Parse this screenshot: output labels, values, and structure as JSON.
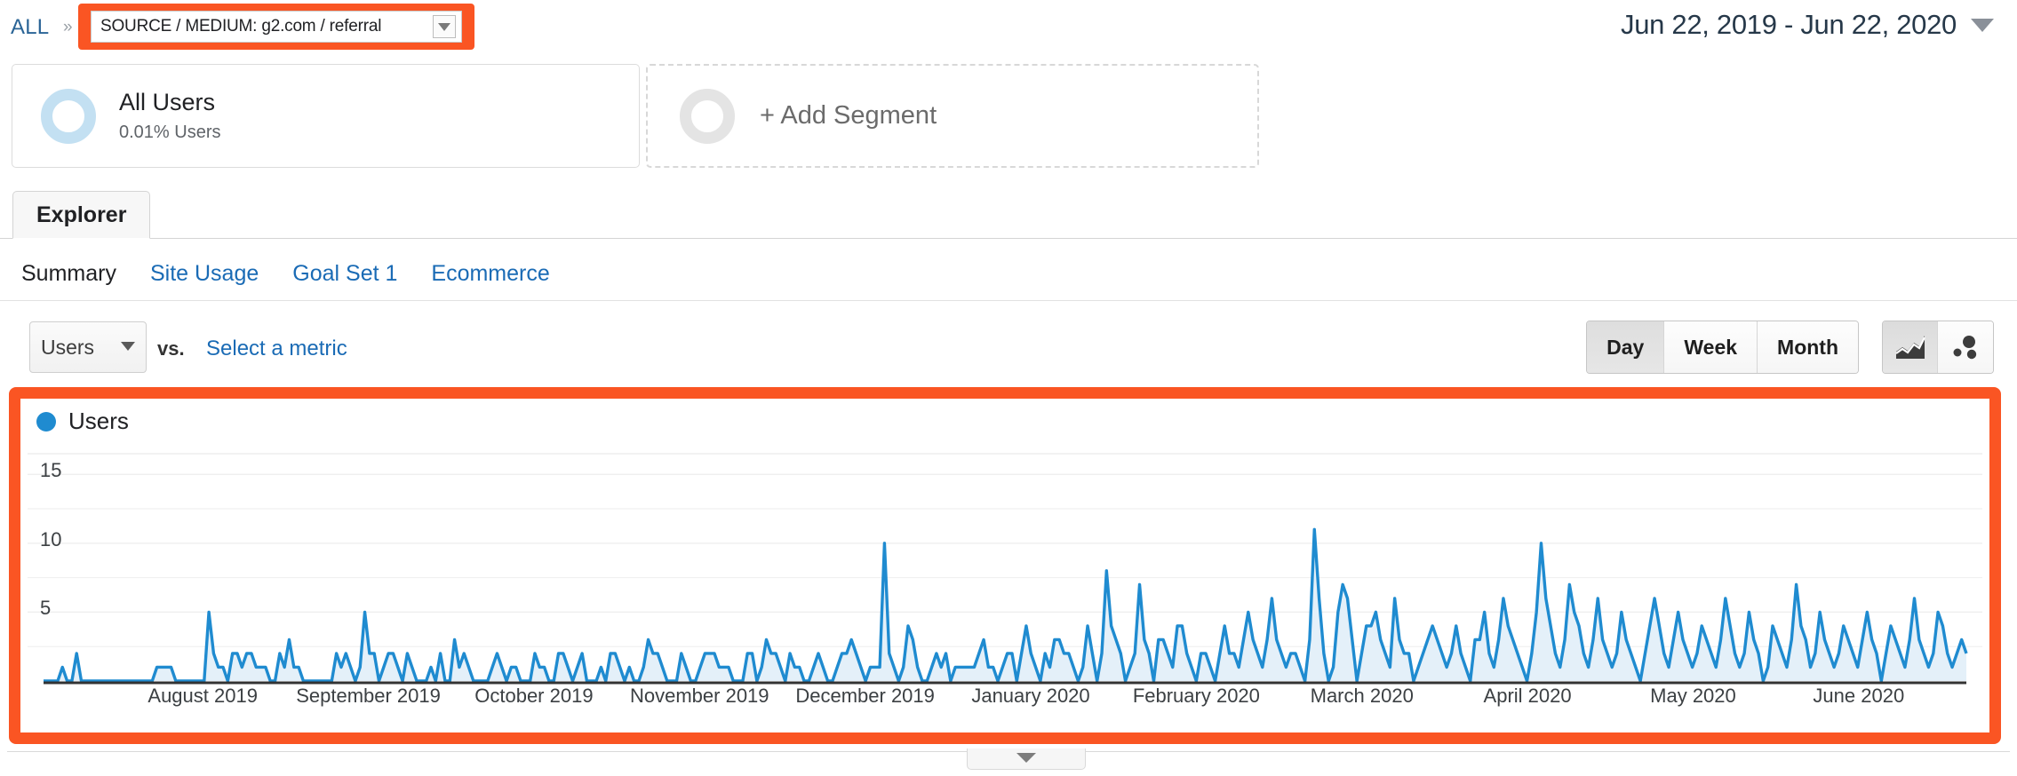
{
  "breadcrumb": {
    "all_label": "ALL",
    "separator": "»",
    "source_filter": "SOURCE / MEDIUM: g2.com / referral",
    "caret_icon": "chevron-down-icon"
  },
  "date_range": {
    "value": "Jun 22, 2019 - Jun 22, 2020",
    "caret_icon": "chevron-down-icon"
  },
  "segments": [
    {
      "title": "All Users",
      "subtitle": "0.01% Users",
      "icon": "donut-icon"
    },
    {
      "title": "+ Add Segment",
      "icon": "donut-outline-icon"
    }
  ],
  "tabs": {
    "explorer": "Explorer"
  },
  "subnav": [
    {
      "label": "Summary",
      "active": true
    },
    {
      "label": "Site Usage",
      "active": false
    },
    {
      "label": "Goal Set 1",
      "active": false
    },
    {
      "label": "Ecommerce",
      "active": false
    }
  ],
  "controls": {
    "metric_selected": "Users",
    "vs_label": "vs.",
    "select_metric_link": "Select a metric",
    "granularity": [
      {
        "label": "Day",
        "active": true
      },
      {
        "label": "Week",
        "active": false
      },
      {
        "label": "Month",
        "active": false
      }
    ],
    "chart_types": [
      {
        "icon": "line-chart-icon",
        "active": true
      },
      {
        "icon": "motion-chart-icon",
        "active": false
      }
    ]
  },
  "chart_data": {
    "type": "area",
    "title": "Users",
    "legend": [
      {
        "name": "Users",
        "color": "#1f8bd0"
      }
    ],
    "legend_position": "top-left",
    "xlabel": "",
    "ylabel": "",
    "ylim": [
      0,
      16.5
    ],
    "yticks": [
      5,
      10,
      15
    ],
    "ytick_labels": [
      "5",
      "10",
      "15"
    ],
    "grid": true,
    "xtick_labels": [
      "August 2019",
      "September 2019",
      "October 2019",
      "November 2019",
      "December 2019",
      "January 2020",
      "February 2020",
      "March 2020",
      "April 2020",
      "May 2020",
      "June 2020"
    ],
    "x_start": "Jun 22, 2019",
    "x_end": "Jun 22, 2020",
    "line_color": "#1f8bd0",
    "fill_color": "#e4f0f9",
    "values": [
      0,
      0,
      0,
      0,
      1,
      0,
      0,
      2,
      0,
      0,
      0,
      0,
      0,
      0,
      0,
      0,
      0,
      0,
      0,
      0,
      0,
      0,
      0,
      0,
      1,
      1,
      1,
      1,
      0,
      0,
      0,
      0,
      0,
      0,
      0,
      5,
      2,
      1,
      1,
      0,
      2,
      2,
      1,
      2,
      2,
      1,
      1,
      1,
      0,
      0,
      2,
      1,
      3,
      1,
      1,
      0,
      0,
      0,
      0,
      0,
      0,
      0,
      2,
      1,
      2,
      1,
      0,
      1,
      5,
      2,
      2,
      0,
      1,
      2,
      2,
      1,
      0,
      2,
      1,
      0,
      0,
      0,
      1,
      0,
      2,
      0,
      0,
      3,
      1,
      2,
      1,
      0,
      0,
      0,
      0,
      1,
      2,
      1,
      0,
      1,
      1,
      0,
      0,
      0,
      2,
      1,
      1,
      0,
      0,
      2,
      2,
      1,
      0,
      1,
      2,
      0,
      0,
      0,
      1,
      0,
      2,
      2,
      1,
      0,
      1,
      0,
      0,
      1,
      3,
      2,
      2,
      1,
      0,
      0,
      0,
      2,
      1,
      0,
      0,
      1,
      2,
      2,
      2,
      1,
      1,
      1,
      0,
      0,
      0,
      2,
      2,
      0,
      1,
      3,
      2,
      2,
      1,
      0,
      2,
      1,
      1,
      0,
      0,
      1,
      2,
      1,
      0,
      0,
      1,
      2,
      2,
      3,
      2,
      1,
      0,
      1,
      1,
      1,
      10,
      2,
      1,
      0,
      1,
      4,
      3,
      1,
      0,
      0,
      1,
      2,
      1,
      2,
      0,
      1,
      1,
      1,
      1,
      1,
      2,
      3,
      1,
      1,
      0,
      1,
      2,
      2,
      0,
      2,
      4,
      2,
      1,
      0,
      2,
      1,
      3,
      3,
      2,
      2,
      1,
      0,
      1,
      4,
      2,
      0,
      2,
      8,
      4,
      3,
      2,
      0,
      1,
      2,
      7,
      3,
      2,
      0,
      3,
      3,
      2,
      1,
      4,
      4,
      2,
      1,
      0,
      2,
      2,
      1,
      0,
      2,
      4,
      2,
      2,
      1,
      3,
      5,
      3,
      2,
      1,
      3,
      6,
      3,
      2,
      1,
      2,
      2,
      1,
      0,
      3,
      11,
      6,
      2,
      0,
      1,
      5,
      7,
      6,
      3,
      0,
      2,
      4,
      4,
      5,
      3,
      2,
      1,
      6,
      3,
      2,
      2,
      0,
      1,
      2,
      3,
      4,
      3,
      2,
      1,
      2,
      4,
      2,
      1,
      0,
      3,
      3,
      5,
      2,
      1,
      3,
      6,
      4,
      3,
      2,
      1,
      0,
      2,
      5,
      10,
      6,
      4,
      2,
      1,
      3,
      7,
      5,
      4,
      2,
      1,
      3,
      6,
      3,
      2,
      1,
      2,
      5,
      3,
      2,
      1,
      0,
      2,
      4,
      6,
      4,
      2,
      1,
      3,
      5,
      3,
      2,
      1,
      2,
      4,
      3,
      2,
      1,
      3,
      6,
      4,
      2,
      1,
      2,
      5,
      3,
      2,
      0,
      1,
      4,
      3,
      2,
      1,
      3,
      7,
      4,
      3,
      1,
      2,
      5,
      3,
      2,
      1,
      2,
      4,
      3,
      2,
      1,
      3,
      5,
      3,
      2,
      0,
      2,
      4,
      3,
      2,
      1,
      3,
      6,
      3,
      2,
      1,
      2,
      5,
      4,
      2,
      1,
      2,
      3,
      2
    ]
  },
  "collapse": {
    "icon": "chevron-down-icon"
  },
  "colors": {
    "highlight": "#fa5523",
    "accent": "#1a6bb5",
    "line": "#1f8bd0",
    "fill": "#e4f0f9"
  }
}
